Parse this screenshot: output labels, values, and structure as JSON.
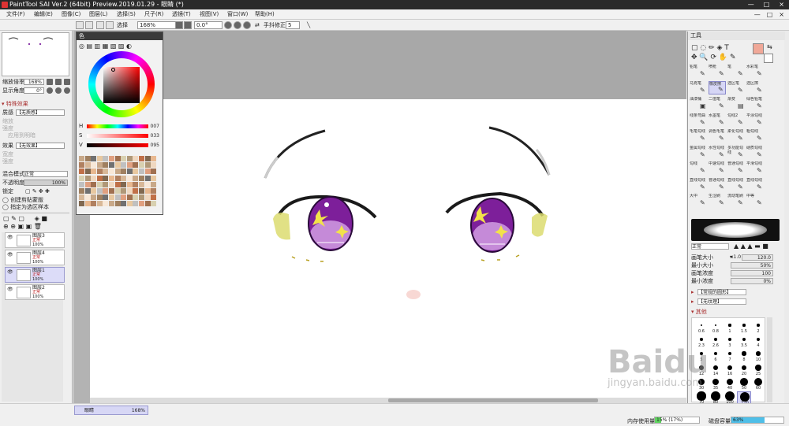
{
  "app": {
    "title": "PaintTool SAI Ver.2 (64bit) Preview.2019.01.29 - 眼睛 (*)",
    "window_controls": [
      "—",
      "□",
      "×"
    ]
  },
  "menu": [
    "文件(F)",
    "编辑(E)",
    "图像(C)",
    "图层(L)",
    "选择(S)",
    "尺子(R)",
    "透镜(T)",
    "视图(V)",
    "窗口(W)",
    "帮助(H)"
  ],
  "toolbar": {
    "selection_label": "选择",
    "zoom": "168%",
    "rotation": "0.0°",
    "stabilizer_label": "手抖修正",
    "stabilizer_value": "5"
  },
  "navigator": {
    "zoom_label": "缩放倍率",
    "zoom_value": "168%",
    "angle_label": "显示角度",
    "angle_value": "0°"
  },
  "layer_panel": {
    "effects_header": "特殊效果",
    "texture_label": "质感",
    "texture_value": "【无质感】",
    "texture_sub": [
      "缩放",
      "强度"
    ],
    "texture_check": "应用到明暗",
    "effect_label": "效果",
    "effect_value": "【无效果】",
    "effect_sub": [
      "宽度",
      "强度"
    ],
    "blend_label": "混合模式",
    "blend_value": "正常",
    "opacity_label": "不透明度",
    "opacity_value": "100%",
    "lock_label": "锁定",
    "clip_label": "创建剪贴蒙版",
    "sample_label": "指定为选区样本",
    "layers": [
      {
        "name": "图层3",
        "mode": "正常",
        "opacity": "100%",
        "selected": false
      },
      {
        "name": "图层4",
        "mode": "正常",
        "opacity": "100%",
        "selected": false
      },
      {
        "name": "图层1",
        "mode": "正常",
        "opacity": "100%",
        "selected": true
      },
      {
        "name": "图层2",
        "mode": "正常",
        "opacity": "100%",
        "selected": false
      }
    ]
  },
  "color_panel": {
    "title": "色",
    "h_label": "H",
    "h_value": "007",
    "s_label": "S",
    "s_value": "033",
    "v_label": "V",
    "v_value": "095",
    "swatch_colors": [
      "#c8a888",
      "#a08060",
      "#707070",
      "#e8c8a0",
      "#c0c0c0",
      "#e0a080",
      "#a07050",
      "#d8d0b0",
      "#b09878",
      "#f0d8c0",
      "#c07048",
      "#806850",
      "#e8b890",
      "#b08060",
      "#d8b898",
      "#f8e8d8"
    ],
    "current_color": "#f0a898"
  },
  "tool_panel": {
    "title": "工具",
    "brushes": [
      {
        "label": "铅笔",
        "icon": "✎"
      },
      {
        "label": "喷枪",
        "icon": "✎"
      },
      {
        "label": "笔",
        "icon": "✎"
      },
      {
        "label": "水彩笔",
        "icon": "✎"
      },
      {
        "label": "马克笔",
        "icon": "✎"
      },
      {
        "label": "橡皮擦",
        "icon": "✎",
        "selected": true
      },
      {
        "label": "选区笔",
        "icon": "✎"
      },
      {
        "label": "选区擦",
        "icon": "✎"
      },
      {
        "label": "油漆桶",
        "icon": "▣"
      },
      {
        "label": "二值笔",
        "icon": "✎"
      },
      {
        "label": "渐变",
        "icon": "▤"
      },
      {
        "label": "绿色铅笔",
        "icon": "✎"
      },
      {
        "label": "线条弯曲",
        "icon": "✎"
      },
      {
        "label": "水墨笔",
        "icon": "✎"
      },
      {
        "label": "勾线2",
        "icon": "✎"
      },
      {
        "label": "平涂勾线",
        "icon": "✎"
      },
      {
        "label": "毛笔勾线",
        "icon": "✎"
      },
      {
        "label": "调色毛笔",
        "icon": "✎"
      },
      {
        "label": "柔化勾线",
        "icon": "✎"
      },
      {
        "label": "粗勾线",
        "icon": "✎"
      },
      {
        "label": "金属勾线",
        "icon": "✎"
      },
      {
        "label": "水性勾线",
        "icon": "✎"
      },
      {
        "label": "多功能勾线",
        "icon": "✎"
      },
      {
        "label": "硬质勾线",
        "icon": "✎"
      },
      {
        "label": "勾线",
        "icon": "✎"
      },
      {
        "label": "中速勾线",
        "icon": "✎"
      },
      {
        "label": "普通勾线",
        "icon": "✎"
      },
      {
        "label": "平滑勾线",
        "icon": "✎"
      },
      {
        "label": "直线勾线",
        "icon": "✎"
      },
      {
        "label": "普通勾线",
        "icon": "✎"
      },
      {
        "label": "直线勾线",
        "icon": "✎"
      },
      {
        "label": "直线勾线",
        "icon": "✎"
      },
      {
        "label": "大中",
        "icon": "✎"
      },
      {
        "label": "生涩刷",
        "icon": "✎"
      },
      {
        "label": "流动笔刷",
        "icon": "✎"
      },
      {
        "label": "中等",
        "icon": "✎"
      }
    ],
    "blend_mode": "正常",
    "brush_size_label": "画笔大小",
    "brush_size_mult": "x1.0",
    "brush_size_value": "120.0",
    "min_size_label": "最小大小",
    "min_size_value": "50%",
    "density_label": "画笔浓度",
    "density_value": "100",
    "min_density_label": "最小浓度",
    "min_density_value": "0%",
    "shape_value": "【常规的圆形】",
    "texture_value": "【无纹理】",
    "other_label": "其他",
    "size_presets": [
      "0.6",
      "0.8",
      "1",
      "1.5",
      "2",
      "2.3",
      "2.6",
      "3",
      "3.5",
      "4",
      "5",
      "6",
      "7",
      "8",
      "10",
      "12",
      "14",
      "16",
      "20",
      "25",
      "30",
      "35",
      "40",
      "50",
      "60",
      "70",
      "80",
      "100",
      "120"
    ]
  },
  "statusbar": {
    "doc_tab": "眼睛",
    "doc_zoom": "168%",
    "memory_label": "内存使用量",
    "memory_value": "15% (17%)",
    "memory_fraction": 0.15,
    "disk_label": "磁盘容量",
    "disk_value": "63%",
    "disk_fraction": 0.63
  },
  "watermark": {
    "line1": "Baidu",
    "line2": "jingyan.baidu.com"
  }
}
